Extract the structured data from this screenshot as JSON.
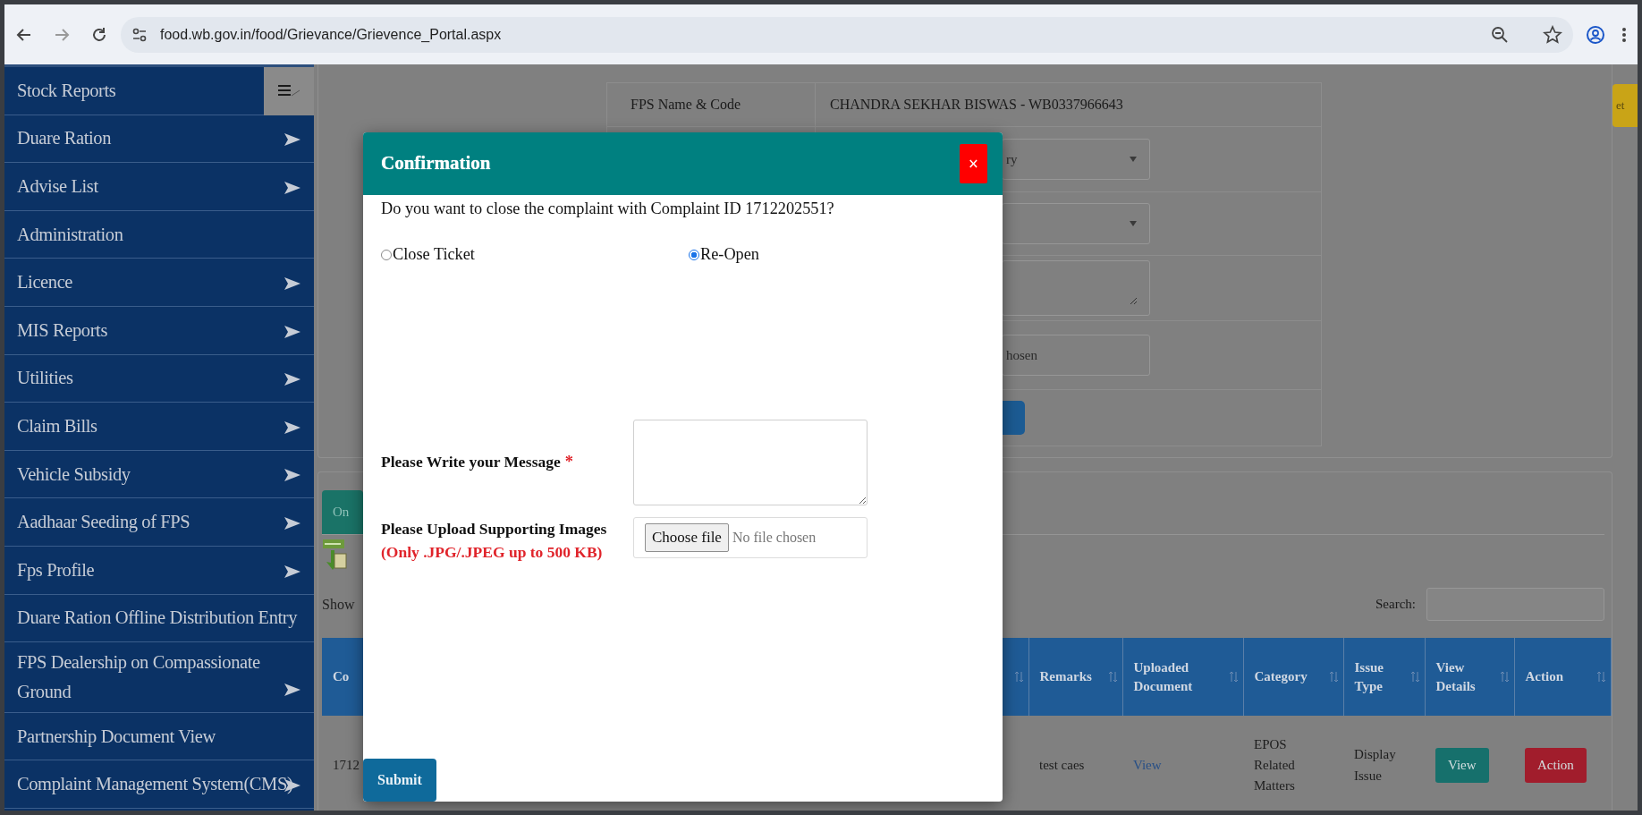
{
  "browser": {
    "url": "food.wb.gov.in/food/Grievance/Grievence_Portal.aspx"
  },
  "sidebar": {
    "items": [
      {
        "label": "Stock Reports",
        "has_submenu": false
      },
      {
        "label": "Duare Ration",
        "has_submenu": true
      },
      {
        "label": "Advise List",
        "has_submenu": true
      },
      {
        "label": "Administration",
        "has_submenu": false
      },
      {
        "label": "Licence",
        "has_submenu": true
      },
      {
        "label": "MIS Reports",
        "has_submenu": true
      },
      {
        "label": "Utilities",
        "has_submenu": true
      },
      {
        "label": "Claim Bills",
        "has_submenu": true
      },
      {
        "label": "Vehicle Subsidy",
        "has_submenu": true
      },
      {
        "label": "Aadhaar Seeding of FPS",
        "has_submenu": true
      },
      {
        "label": "Fps Profile",
        "has_submenu": true
      },
      {
        "label": "Duare Ration Offline Distribution Entry",
        "has_submenu": false
      },
      {
        "label": "FPS Dealership on Compassionate Ground",
        "has_submenu": true
      },
      {
        "label": "Partnership Document View",
        "has_submenu": false
      },
      {
        "label": "Complaint Management System(CMS)",
        "has_submenu": true
      }
    ]
  },
  "page": {
    "corner_button": "et",
    "form": {
      "rows": [
        {
          "kind": "text",
          "label": "FPS Name & Code",
          "value": "CHANDRA SEKHAR BISWAS - WB0337966643"
        },
        {
          "kind": "select",
          "value": "ry"
        },
        {
          "kind": "select"
        },
        {
          "kind": "textarea"
        },
        {
          "kind": "file",
          "value": "hosen"
        },
        {
          "kind": "button"
        }
      ]
    },
    "tabs": [
      {
        "label": "On",
        "selected": true
      }
    ],
    "show_label": "Show",
    "search_label": "Search:",
    "table": {
      "columns": [
        "Co",
        "Remarks",
        "Uploaded Document",
        "Category",
        "Issue Type",
        "View Details",
        "Action"
      ],
      "rows": [
        {
          "cells": [
            {
              "kind": "text",
              "text": "1712"
            },
            {
              "kind": "text",
              "text": "test caes"
            },
            {
              "kind": "link",
              "text": "View"
            },
            {
              "kind": "text",
              "text": "EPOS Related Matters"
            },
            {
              "kind": "text",
              "text": "Display Issue"
            },
            {
              "kind": "button",
              "text": "View",
              "color": "#16706c"
            },
            {
              "kind": "button",
              "text": "Action",
              "color": "#a11d2c"
            }
          ]
        }
      ]
    }
  },
  "modal": {
    "title": "Confirmation",
    "close": "×",
    "question": "Do you want to close the complaint with Complaint ID 1712202551?",
    "options": [
      {
        "label": "Close Ticket",
        "selected": false
      },
      {
        "label": "Re-Open",
        "selected": true
      }
    ],
    "message_label": "Please Write your Message",
    "required_mark": "*",
    "upload_label": "Please Upload Supporting Images",
    "upload_note": "(Only .JPG/.JPEG up to 500 KB)",
    "file_button": "Choose file",
    "file_status": "No file chosen",
    "submit": "Submit"
  }
}
